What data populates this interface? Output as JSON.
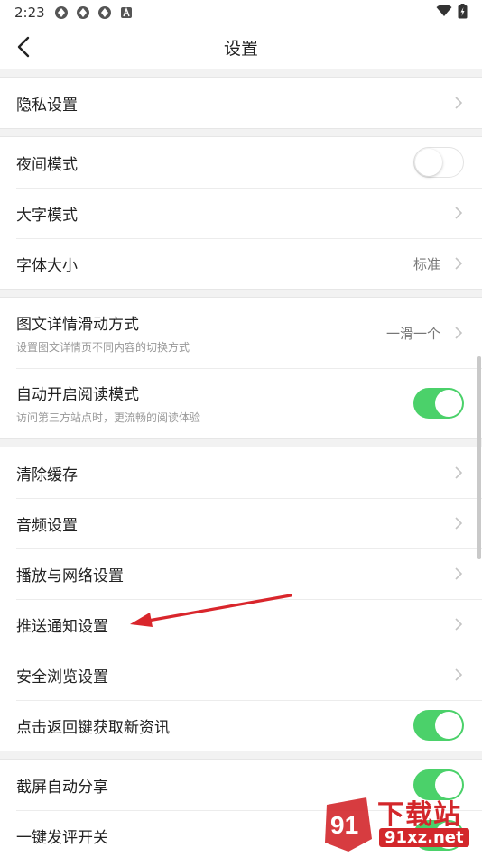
{
  "status_bar": {
    "time": "2:23",
    "icons": [
      "app-icon",
      "app-icon",
      "app-icon",
      "a-badge-icon"
    ],
    "right_icons": [
      "wifi-icon",
      "battery-icon"
    ]
  },
  "header": {
    "title": "设置",
    "back_icon": "back-arrow-icon"
  },
  "groups": [
    {
      "rows": [
        {
          "label": "隐私设置",
          "control": "chevron"
        }
      ]
    },
    {
      "rows": [
        {
          "label": "夜间模式",
          "control": "toggle",
          "on": false
        },
        {
          "label": "大字模式",
          "control": "chevron"
        },
        {
          "label": "字体大小",
          "value": "标准",
          "control": "chevron"
        }
      ]
    },
    {
      "rows": [
        {
          "label": "图文详情滑动方式",
          "sub": "设置图文详情页不同内容的切换方式",
          "value": "一滑一个",
          "control": "chevron"
        },
        {
          "label": "自动开启阅读模式",
          "sub": "访问第三方站点时，更流畅的阅读体验",
          "control": "toggle",
          "on": true
        }
      ]
    },
    {
      "rows": [
        {
          "label": "清除缓存",
          "control": "chevron"
        },
        {
          "label": "音频设置",
          "control": "chevron"
        },
        {
          "label": "播放与网络设置",
          "control": "chevron"
        },
        {
          "label": "推送通知设置",
          "control": "chevron"
        },
        {
          "label": "安全浏览设置",
          "control": "chevron"
        },
        {
          "label": "点击返回键获取新资讯",
          "control": "toggle",
          "on": true
        }
      ]
    },
    {
      "rows": [
        {
          "label": "截屏自动分享",
          "control": "toggle",
          "on": true
        },
        {
          "label": "一键发评开关",
          "control": "toggle",
          "on": true
        }
      ]
    }
  ],
  "colors": {
    "toggle_on": "#4bd16a",
    "annotation_arrow": "#d9262c",
    "watermark": "#d3272b"
  },
  "watermark": {
    "text_cn": "下载站",
    "url": "91xz.net",
    "logo_text": "91"
  }
}
